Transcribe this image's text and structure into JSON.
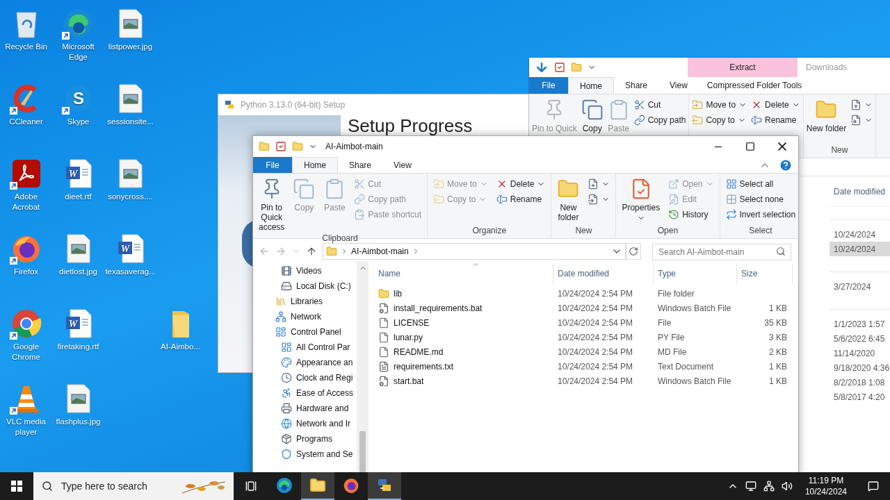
{
  "desktop": {
    "icons": [
      {
        "label": "Recycle Bin",
        "kind": "recycle-bin",
        "shortcut": false
      },
      {
        "label": "CCleaner",
        "kind": "ccleaner",
        "shortcut": true
      },
      {
        "label": "Adobe Acrobat",
        "kind": "acrobat",
        "shortcut": true
      },
      {
        "label": "Firefox",
        "kind": "firefox",
        "shortcut": true
      },
      {
        "label": "Google Chrome",
        "kind": "chrome",
        "shortcut": true
      },
      {
        "label": "VLC media player",
        "kind": "vlc",
        "shortcut": true
      },
      {
        "label": "Microsoft Edge",
        "kind": "edge",
        "shortcut": true
      },
      {
        "label": "Skype",
        "kind": "skype",
        "shortcut": true,
        "letter": "S"
      },
      {
        "label": "dieet.rtf",
        "kind": "word",
        "shortcut": false,
        "letter": "W"
      },
      {
        "label": "dietlost.jpg",
        "kind": "image",
        "shortcut": false
      },
      {
        "label": "firetaking.rtf",
        "kind": "word",
        "shortcut": false,
        "letter": "W"
      },
      {
        "label": "flashplus.jpg",
        "kind": "image",
        "shortcut": false
      },
      {
        "label": "listpower.jpg",
        "kind": "image",
        "shortcut": false
      },
      {
        "label": "sessionsite...",
        "kind": "image",
        "shortcut": false
      },
      {
        "label": "sonycross....",
        "kind": "image",
        "shortcut": false
      },
      {
        "label": "texasaverag...",
        "kind": "word",
        "shortcut": false,
        "letter": "W"
      }
    ],
    "loose_icon": {
      "label": "AI-Aimbo...",
      "kind": "folder",
      "shortcut": false
    }
  },
  "python_setup": {
    "title": "Python 3.13.0 (64-bit) Setup",
    "heading": "Setup Progress"
  },
  "downloads_window": {
    "title": "Downloads",
    "context_tab": "Extract",
    "tabs": [
      {
        "label": "File",
        "kind": "file",
        "selected": false
      },
      {
        "label": "Home",
        "kind": "tab",
        "selected": true
      },
      {
        "label": "Share",
        "kind": "tab",
        "selected": false
      },
      {
        "label": "View",
        "kind": "tab",
        "selected": false
      },
      {
        "label": "Compressed Folder Tools",
        "kind": "context",
        "selected": false
      }
    ],
    "ribbon": [
      {
        "columns": [
          [
            {
              "label": "Pin to Quick",
              "kind": "pin",
              "disabled": true,
              "dropdown": false
            }
          ],
          [
            {
              "label": "Copy",
              "kind": "copy",
              "disabled": false,
              "dropdown": false
            }
          ],
          [
            {
              "label": "Paste",
              "kind": "paste",
              "disabled": true,
              "dropdown": false
            }
          ],
          [
            {
              "label": "Cut",
              "kind": "cut",
              "disabled": false,
              "dropdown": false
            },
            {
              "label": "Copy path",
              "kind": "copy-path",
              "disabled": false,
              "dropdown": false
            }
          ]
        ]
      },
      {
        "columns": [
          [
            {
              "label": "Move to",
              "kind": "move-to",
              "disabled": false,
              "dropdown": true
            },
            {
              "label": "Copy to",
              "kind": "copy-to",
              "disabled": false,
              "dropdown": true
            }
          ],
          [
            {
              "label": "Delete",
              "kind": "delete",
              "disabled": false,
              "dropdown": true
            },
            {
              "label": "Rename",
              "kind": "rename",
              "disabled": false,
              "dropdown": false
            }
          ]
        ]
      },
      {
        "label": "New",
        "columns": [
          [
            {
              "label": "New folder",
              "kind": "new-folder",
              "disabled": false,
              "dropdown": false
            }
          ],
          [
            {
              "kind": "new-item",
              "disabled": false,
              "dropdown": true
            },
            {
              "kind": "easy-access",
              "disabled": false,
              "dropdown": true
            }
          ]
        ]
      }
    ],
    "list": {
      "column": "Date modified",
      "groups": [
        {
          "rows": [
            {
              "date": "10/24/2024",
              "selected": false
            },
            {
              "date": "10/24/2024",
              "selected": true
            }
          ]
        },
        {
          "rows": [
            {
              "date": "3/27/2024",
              "selected": false
            }
          ]
        },
        {
          "rows": [
            {
              "date": "1/1/2023 1:57",
              "selected": false
            },
            {
              "date": "5/6/2022 6:45",
              "selected": false
            },
            {
              "date": "11/14/2020",
              "selected": false
            },
            {
              "date": "9/18/2020 4:36",
              "selected": false
            },
            {
              "date": "8/2/2018 1:08",
              "selected": false
            },
            {
              "date": "5/8/2017 4:20",
              "selected": false
            }
          ]
        }
      ]
    }
  },
  "explorer": {
    "title": "AI-Aimbot-main",
    "tabs": [
      {
        "label": "File",
        "kind": "file",
        "selected": false
      },
      {
        "label": "Home",
        "kind": "tab",
        "selected": true
      },
      {
        "label": "Share",
        "kind": "tab",
        "selected": false
      },
      {
        "label": "View",
        "kind": "tab",
        "selected": false
      }
    ],
    "ribbon": [
      {
        "label": "Clipboard",
        "columns": [
          [
            {
              "label": "Pin to Quick access",
              "kind": "pin",
              "disabled": false,
              "dropdown": false
            }
          ],
          [
            {
              "label": "Copy",
              "kind": "copy",
              "disabled": true,
              "dropdown": false
            }
          ],
          [
            {
              "label": "Paste",
              "kind": "paste",
              "disabled": true,
              "dropdown": false
            }
          ],
          [
            {
              "label": "Cut",
              "kind": "cut",
              "disabled": true,
              "dropdown": false
            },
            {
              "label": "Copy path",
              "kind": "copy-path",
              "disabled": true,
              "dropdown": false
            },
            {
              "label": "Paste shortcut",
              "kind": "paste-shortcut",
              "disabled": true,
              "dropdown": false
            }
          ]
        ]
      },
      {
        "label": "Organize",
        "columns": [
          [
            {
              "label": "Move to",
              "kind": "move-to",
              "disabled": true,
              "dropdown": true
            },
            {
              "label": "Copy to",
              "kind": "copy-to",
              "disabled": true,
              "dropdown": true
            }
          ],
          [
            {
              "label": "Delete",
              "kind": "delete",
              "disabled": false,
              "dropdown": true
            },
            {
              "label": "Rename",
              "kind": "rename",
              "disabled": false,
              "dropdown": false
            }
          ]
        ]
      },
      {
        "label": "New",
        "columns": [
          [
            {
              "label": "New folder",
              "kind": "new-folder",
              "disabled": false,
              "dropdown": false
            }
          ],
          [
            {
              "kind": "new-item",
              "disabled": false,
              "dropdown": true
            },
            {
              "kind": "easy-access",
              "disabled": false,
              "dropdown": true
            }
          ]
        ]
      },
      {
        "label": "Open",
        "columns": [
          [
            {
              "label": "Properties",
              "kind": "properties",
              "disabled": false,
              "dropdown": true
            }
          ],
          [
            {
              "label": "Open",
              "kind": "open",
              "disabled": true,
              "dropdown": true
            },
            {
              "label": "Edit",
              "kind": "edit",
              "disabled": true,
              "dropdown": false
            },
            {
              "label": "History",
              "kind": "history",
              "disabled": false,
              "dropdown": false
            }
          ]
        ]
      },
      {
        "label": "Select",
        "columns": [
          [
            {
              "label": "Select all",
              "kind": "select-all",
              "disabled": false,
              "dropdown": false
            },
            {
              "label": "Select none",
              "kind": "select-none",
              "disabled": false,
              "dropdown": false
            },
            {
              "label": "Invert selection",
              "kind": "invert-selection",
              "disabled": false,
              "dropdown": false
            }
          ]
        ]
      }
    ],
    "address": {
      "path": "AI-Aimbot-main",
      "search_placeholder": "Search AI-Aimbot-main"
    },
    "nav_pane": [
      {
        "children": [
          {
            "label": "Videos",
            "kind": "videos"
          },
          {
            "label": "Local Disk (C:)",
            "kind": "disk"
          }
        ]
      },
      {
        "label": "Libraries",
        "kind": "libraries"
      },
      {
        "label": "Network",
        "kind": "network"
      },
      {
        "label": "Control Panel",
        "kind": "control-panel",
        "children": [
          {
            "label": "All Control Par",
            "kind": "control-panel"
          },
          {
            "label": "Appearance an",
            "kind": "appearance"
          },
          {
            "label": "Clock and Regi",
            "kind": "clock"
          },
          {
            "label": "Ease of Access",
            "kind": "ease"
          },
          {
            "label": "Hardware and",
            "kind": "hardware"
          },
          {
            "label": "Network and Ir",
            "kind": "internet"
          },
          {
            "label": "Programs",
            "kind": "programs"
          },
          {
            "label": "System and Se",
            "kind": "system"
          }
        ]
      }
    ],
    "columns": [
      "Name",
      "Date modified",
      "Type",
      "Size"
    ],
    "files": [
      {
        "name": "lib",
        "kind": "folder",
        "date": "10/24/2024 2:54 PM",
        "type": "File folder"
      },
      {
        "name": "install_requirements.bat",
        "kind": "batch",
        "date": "10/24/2024 2:54 PM",
        "type": "Windows Batch File",
        "size": "1 KB"
      },
      {
        "name": "LICENSE",
        "kind": "file",
        "date": "10/24/2024 2:54 PM",
        "type": "File",
        "size": "35 KB"
      },
      {
        "name": "lunar.py",
        "kind": "file",
        "date": "10/24/2024 2:54 PM",
        "type": "PY File",
        "size": "3 KB"
      },
      {
        "name": "README.md",
        "kind": "file",
        "date": "10/24/2024 2:54 PM",
        "type": "MD File",
        "size": "2 KB"
      },
      {
        "name": "requirements.txt",
        "kind": "text",
        "date": "10/24/2024 2:54 PM",
        "type": "Text Document",
        "size": "1 KB"
      },
      {
        "name": "start.bat",
        "kind": "batch",
        "date": "10/24/2024 2:54 PM",
        "type": "Windows Batch File",
        "size": "1 KB"
      }
    ]
  },
  "taskbar": {
    "search_placeholder": "Type here to search",
    "apps": [
      {
        "kind": "edge",
        "active": false
      },
      {
        "kind": "explorer",
        "active": true
      },
      {
        "kind": "firefox",
        "active": false
      },
      {
        "kind": "python-setup",
        "active": true
      }
    ],
    "time": "11:19 PM",
    "date": "10/24/2024"
  }
}
